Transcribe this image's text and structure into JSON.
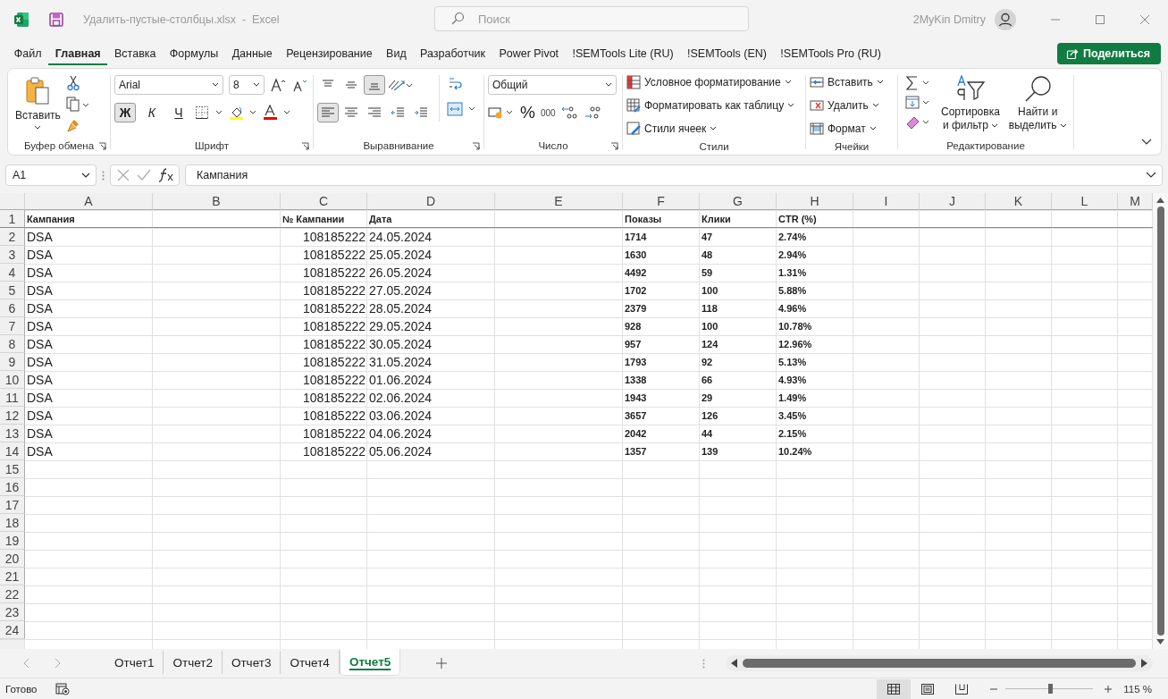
{
  "window": {
    "app": "Excel",
    "file": "Удалить-пустые-столбцы.xlsx",
    "separator": "-",
    "search_placeholder": "Поиск",
    "user": "2MyKin Dmitry"
  },
  "menu_tabs": [
    {
      "label": "Файл",
      "selected": false
    },
    {
      "label": "Главная",
      "selected": true
    },
    {
      "label": "Вставка",
      "selected": false
    },
    {
      "label": "Формулы",
      "selected": false
    },
    {
      "label": "Данные",
      "selected": false
    },
    {
      "label": "Рецензирование",
      "selected": false
    },
    {
      "label": "Вид",
      "selected": false
    },
    {
      "label": "Разработчик",
      "selected": false
    },
    {
      "label": "Power Pivot",
      "selected": false
    },
    {
      "label": "!SEMTools Lite (RU)",
      "selected": false
    },
    {
      "label": "!SEMTools (EN)",
      "selected": false
    },
    {
      "label": "!SEMTools Pro (RU)",
      "selected": false
    }
  ],
  "share_button": "Поделиться",
  "ribbon": {
    "clipboard": {
      "label": "Буфер обмена",
      "paste": "Вставить"
    },
    "font": {
      "label": "Шрифт",
      "font_name": "Arial",
      "font_size": "8",
      "bold": "Ж",
      "italic": "К",
      "underline": "Ч",
      "bold_on": true
    },
    "alignment": {
      "label": "Выравнивание",
      "vertical": [
        {
          "selected": false
        },
        {
          "selected": false
        },
        {
          "selected": true
        }
      ],
      "horizontal": [
        {
          "selected": true
        },
        {
          "selected": false
        },
        {
          "selected": false
        }
      ]
    },
    "number": {
      "label": "Число",
      "format": "Общий",
      "percent": "%",
      "thousands": "000"
    },
    "styles": {
      "label": "Стили",
      "items": [
        {
          "label": "Условное форматирование",
          "kind": "conditional"
        },
        {
          "label": "Форматировать как таблицу",
          "kind": "table"
        },
        {
          "label": "Стили ячеек",
          "kind": "cellstyle"
        }
      ]
    },
    "cells": {
      "label": "Ячейки",
      "items": [
        {
          "label": "Вставить",
          "kind": "insert"
        },
        {
          "label": "Удалить",
          "kind": "delete"
        },
        {
          "label": "Формат",
          "kind": "format"
        }
      ]
    },
    "editing": {
      "label": "Редактирование",
      "sort": [
        "Сортировка",
        "и фильтр"
      ],
      "find": [
        "Найти и",
        "выделить"
      ]
    }
  },
  "formula_bar": {
    "cell_ref": "A1",
    "content": "Кампания"
  },
  "sheet": {
    "columns": [
      "A",
      "B",
      "C",
      "D",
      "E",
      "F",
      "G",
      "H",
      "I",
      "J",
      "K",
      "L",
      "M"
    ],
    "rows": [
      {
        "number": "1",
        "kind": "header",
        "cells": {
          "A": "Кампания",
          "C": "№ Кампании",
          "D": "Дата",
          "F": "Показы",
          "G": "Клики",
          "H": "CTR (%)"
        }
      },
      {
        "number": "2",
        "kind": "data",
        "cells": {
          "A": "DSA",
          "C": "108185222",
          "D": "24.05.2024",
          "F": "1714",
          "G": "47",
          "H": "2.74%"
        }
      },
      {
        "number": "3",
        "kind": "data",
        "cells": {
          "A": "DSA",
          "C": "108185222",
          "D": "25.05.2024",
          "F": "1630",
          "G": "48",
          "H": "2.94%"
        }
      },
      {
        "number": "4",
        "kind": "data",
        "cells": {
          "A": "DSA",
          "C": "108185222",
          "D": "26.05.2024",
          "F": "4492",
          "G": "59",
          "H": "1.31%"
        }
      },
      {
        "number": "5",
        "kind": "data",
        "cells": {
          "A": "DSA",
          "C": "108185222",
          "D": "27.05.2024",
          "F": "1702",
          "G": "100",
          "H": "5.88%"
        }
      },
      {
        "number": "6",
        "kind": "data",
        "cells": {
          "A": "DSA",
          "C": "108185222",
          "D": "28.05.2024",
          "F": "2379",
          "G": "118",
          "H": "4.96%"
        }
      },
      {
        "number": "7",
        "kind": "data",
        "cells": {
          "A": "DSA",
          "C": "108185222",
          "D": "29.05.2024",
          "F": "928",
          "G": "100",
          "H": "10.78%"
        }
      },
      {
        "number": "8",
        "kind": "data",
        "cells": {
          "A": "DSA",
          "C": "108185222",
          "D": "30.05.2024",
          "F": "957",
          "G": "124",
          "H": "12.96%"
        }
      },
      {
        "number": "9",
        "kind": "data",
        "cells": {
          "A": "DSA",
          "C": "108185222",
          "D": "31.05.2024",
          "F": "1793",
          "G": "92",
          "H": "5.13%"
        }
      },
      {
        "number": "10",
        "kind": "data",
        "cells": {
          "A": "DSA",
          "C": "108185222",
          "D": "01.06.2024",
          "F": "1338",
          "G": "66",
          "H": "4.93%"
        }
      },
      {
        "number": "11",
        "kind": "data",
        "cells": {
          "A": "DSA",
          "C": "108185222",
          "D": "02.06.2024",
          "F": "1943",
          "G": "29",
          "H": "1.49%"
        }
      },
      {
        "number": "12",
        "kind": "data",
        "cells": {
          "A": "DSA",
          "C": "108185222",
          "D": "03.06.2024",
          "F": "3657",
          "G": "126",
          "H": "3.45%"
        }
      },
      {
        "number": "13",
        "kind": "data",
        "cells": {
          "A": "DSA",
          "C": "108185222",
          "D": "04.06.2024",
          "F": "2042",
          "G": "44",
          "H": "2.15%"
        }
      },
      {
        "number": "14",
        "kind": "data",
        "cells": {
          "A": "DSA",
          "C": "108185222",
          "D": "05.06.2024",
          "F": "1357",
          "G": "139",
          "H": "10.24%"
        }
      },
      {
        "number": "15",
        "kind": "data",
        "cells": {}
      },
      {
        "number": "16",
        "kind": "data",
        "cells": {}
      },
      {
        "number": "17",
        "kind": "data",
        "cells": {}
      },
      {
        "number": "18",
        "kind": "data",
        "cells": {}
      },
      {
        "number": "19",
        "kind": "data",
        "cells": {}
      },
      {
        "number": "20",
        "kind": "data",
        "cells": {}
      },
      {
        "number": "21",
        "kind": "data",
        "cells": {}
      },
      {
        "number": "22",
        "kind": "data",
        "cells": {}
      },
      {
        "number": "23",
        "kind": "data",
        "cells": {}
      },
      {
        "number": "24",
        "kind": "data",
        "cells": {}
      }
    ]
  },
  "sheet_tabs": [
    {
      "label": "Отчет1",
      "selected": false
    },
    {
      "label": "Отчет2",
      "selected": false
    },
    {
      "label": "Отчет3",
      "selected": false
    },
    {
      "label": "Отчет4",
      "selected": false
    },
    {
      "label": "Отчет5",
      "selected": true
    }
  ],
  "status_bar": {
    "ready": "Готово",
    "views": [
      {
        "kind": "normal",
        "selected": true
      },
      {
        "kind": "page",
        "selected": false
      },
      {
        "kind": "break",
        "selected": false
      }
    ],
    "zoom": {
      "level": 0.52,
      "reading": "115 %"
    }
  }
}
